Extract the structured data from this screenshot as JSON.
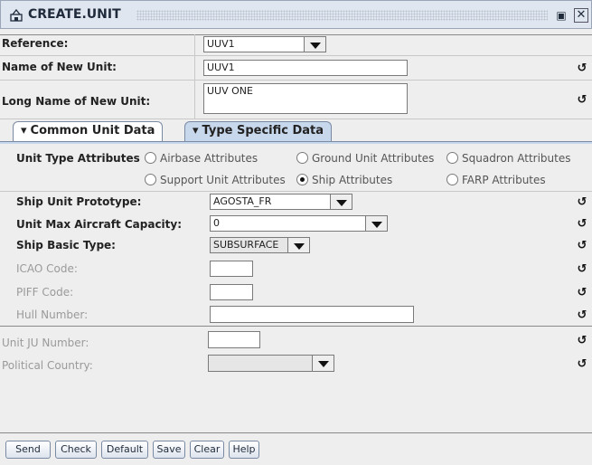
{
  "window": {
    "title": "CREATE.UNIT",
    "icon": "unit-icon",
    "max_icon": "maximize-icon",
    "close_icon": "close-icon"
  },
  "top": {
    "reference_label": "Reference:",
    "reference_value": "UUV1",
    "name_label": "Name of New Unit:",
    "name_value": "UUV1",
    "long_name_label": "Long Name of New Unit:",
    "long_name_value": "UUV ONE"
  },
  "tabs": [
    {
      "label": "Common Unit Data",
      "active": false
    },
    {
      "label": "Type Specific Data",
      "active": true
    }
  ],
  "unit_type": {
    "label": "Unit Type Attributes",
    "options": [
      {
        "label": "Airbase Attributes",
        "selected": false
      },
      {
        "label": "Ground Unit Attributes",
        "selected": false
      },
      {
        "label": "Squadron Attributes",
        "selected": false
      },
      {
        "label": "Support Unit Attributes",
        "selected": false
      },
      {
        "label": "Ship Attributes",
        "selected": true
      },
      {
        "label": "FARP Attributes",
        "selected": false
      }
    ]
  },
  "fields": {
    "ship_prototype_label": "Ship Unit Prototype:",
    "ship_prototype_value": "AGOSTA_FR",
    "max_aircraft_label": "Unit Max Aircraft Capacity:",
    "max_aircraft_value": "0",
    "ship_basic_type_label": "Ship Basic Type:",
    "ship_basic_type_value": "SUBSURFACE",
    "icao_label": "ICAO Code:",
    "icao_value": "",
    "piff_label": "PIFF Code:",
    "piff_value": "",
    "hull_label": "Hull Number:",
    "hull_value": "",
    "unit_ju_label": "Unit JU Number:",
    "unit_ju_value": "",
    "country_label": "Political Country:",
    "country_value": ""
  },
  "undo_icon": "undo-icon",
  "buttons": [
    "Send",
    "Check",
    "Default",
    "Save",
    "Clear",
    "Help"
  ]
}
